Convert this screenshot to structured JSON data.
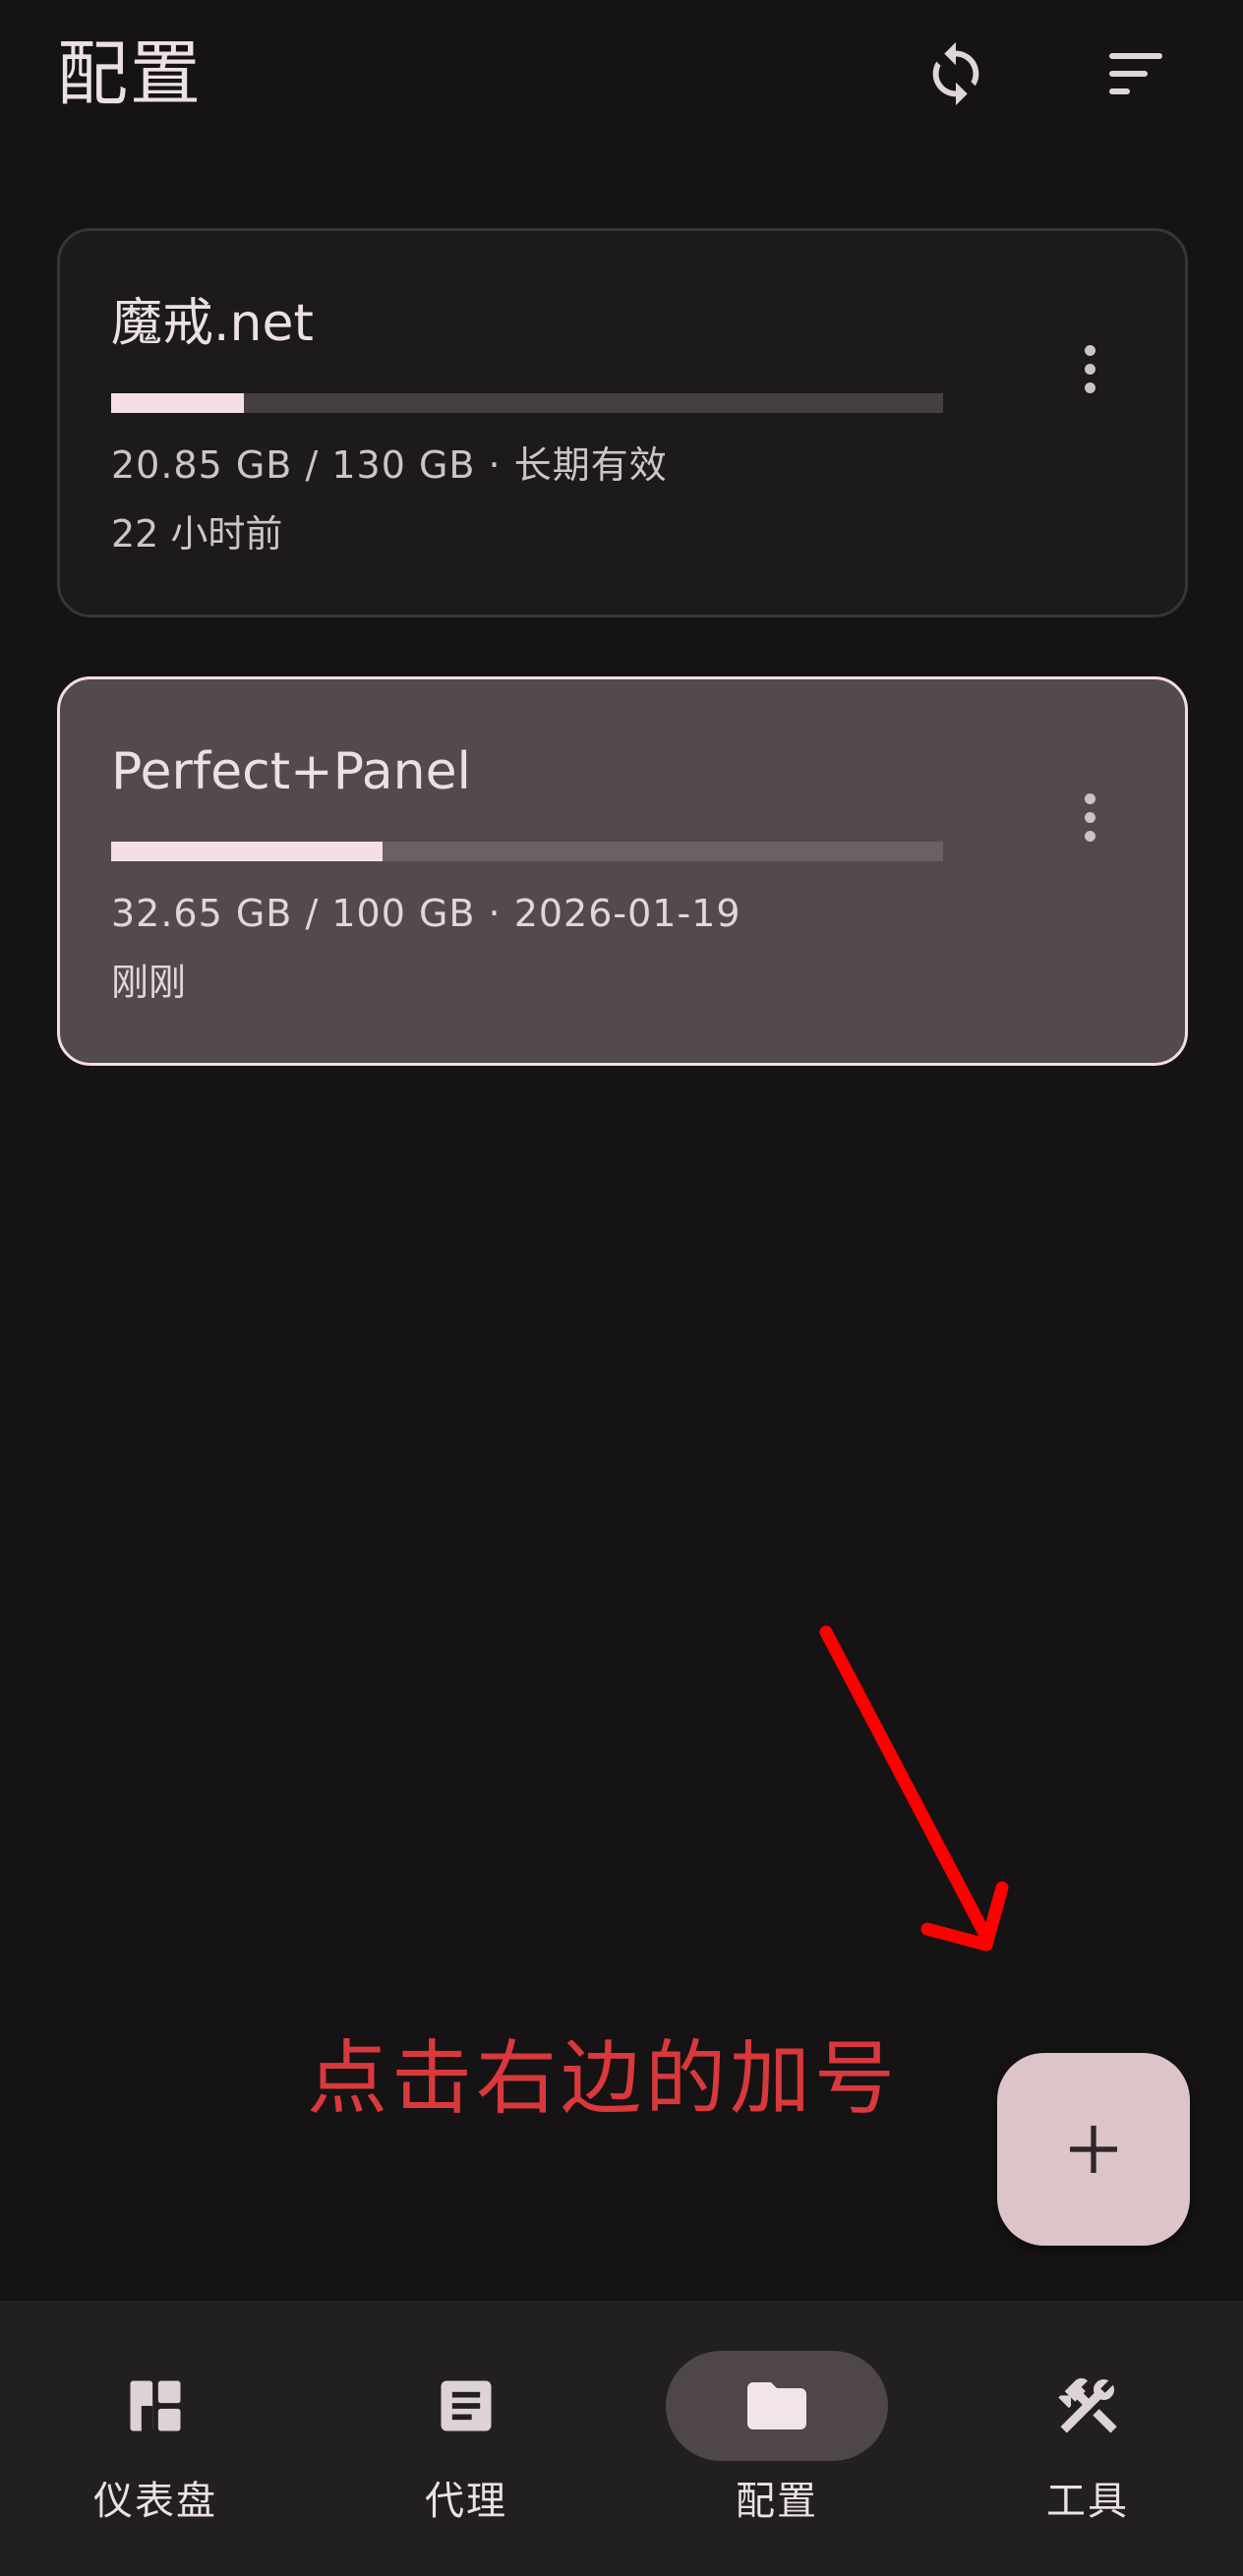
{
  "header": {
    "title": "配置",
    "sync_icon": "sync-icon",
    "sort_icon": "sort-icon"
  },
  "profiles": [
    {
      "name": "魔戒.net",
      "usage": "20.85 GB / 130 GB · 长期有效",
      "updated": "22 小时前",
      "progress": 0.16,
      "selected": false
    },
    {
      "name": "Perfect+Panel",
      "usage": "32.65 GB / 100 GB · 2026-01-19",
      "updated": "刚刚",
      "progress": 0.3265,
      "selected": true
    }
  ],
  "annotation": {
    "text": "点击右边的加号",
    "color": "#d9393c"
  },
  "fab": {
    "icon": "plus-icon"
  },
  "bottom_nav": {
    "items": [
      {
        "label": "仪表盘",
        "icon": "dashboard-icon",
        "active": false
      },
      {
        "label": "代理",
        "icon": "article-icon",
        "active": false
      },
      {
        "label": "配置",
        "icon": "folder-icon",
        "active": true
      },
      {
        "label": "工具",
        "icon": "tools-icon",
        "active": false
      }
    ]
  },
  "colors": {
    "background": "#151314",
    "progress_fill": "#f6dfe4",
    "selected_card": "#524a4c",
    "fab": "#dcc4c8"
  }
}
